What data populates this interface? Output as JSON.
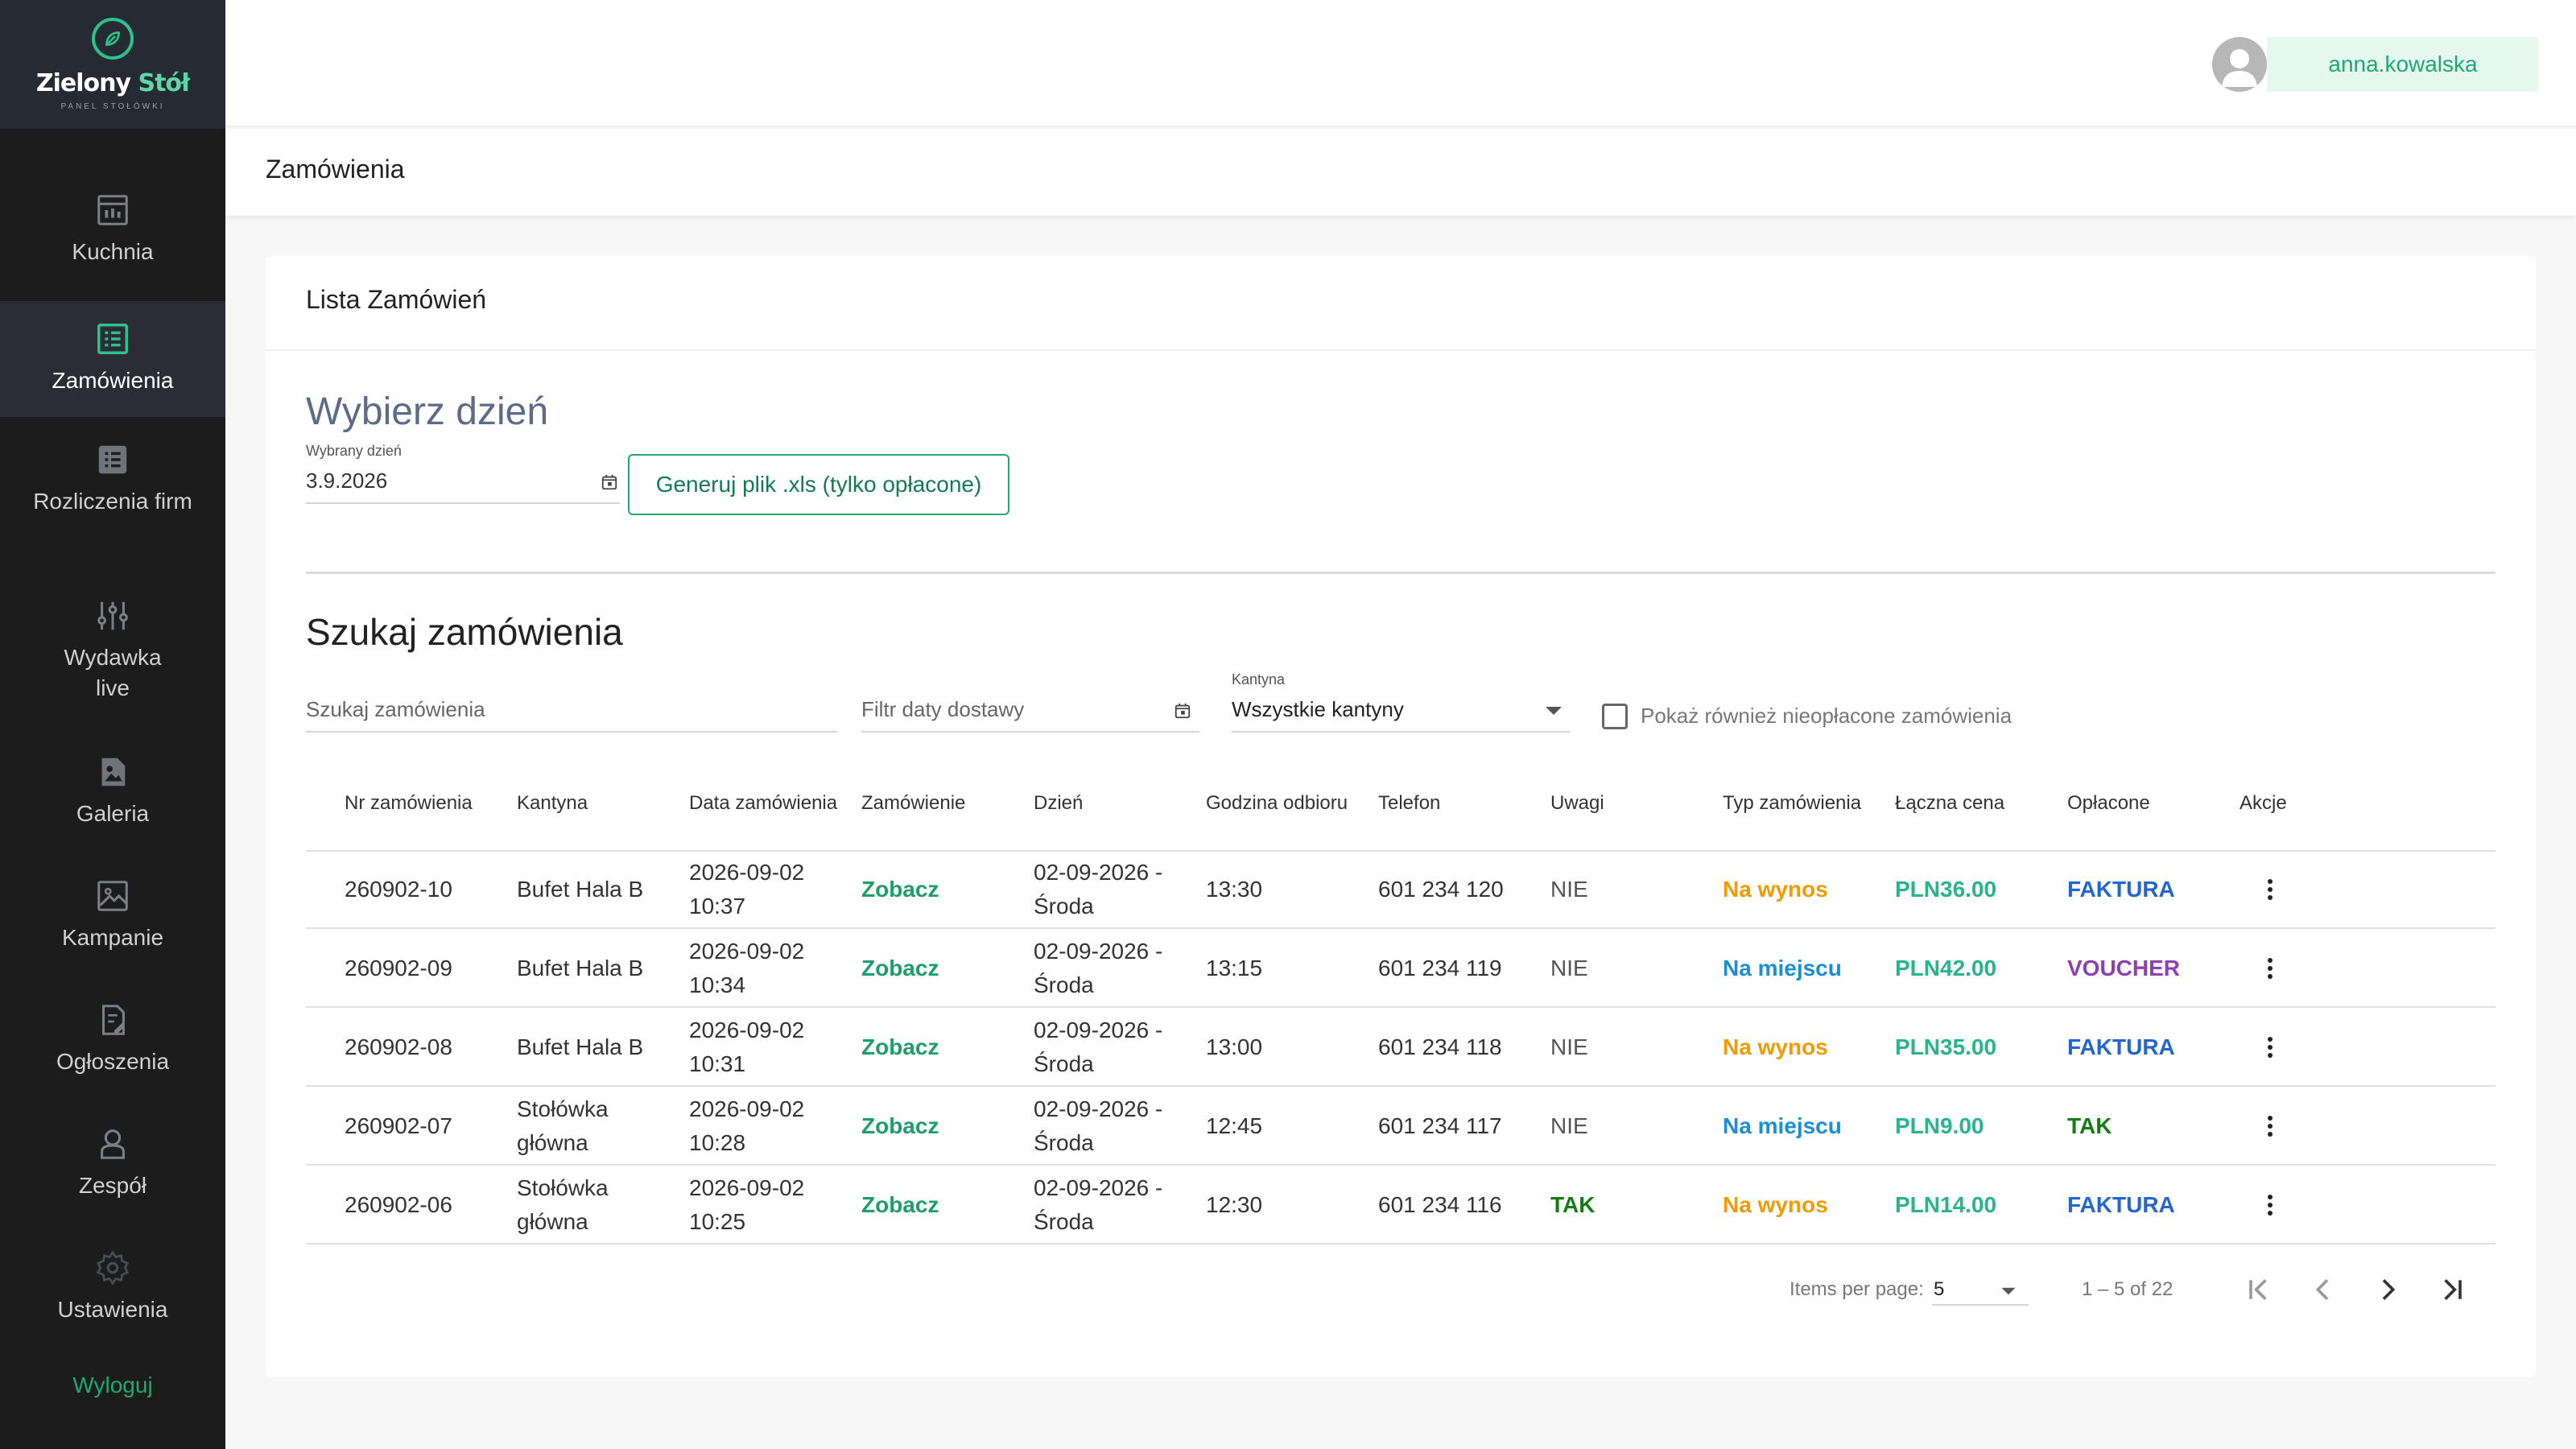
{
  "brand": {
    "title_main": "Zielony ",
    "title_accent": "Stół",
    "subtitle": "PANEL STOŁÓWKI"
  },
  "sidebar": {
    "items": [
      {
        "label": "Kuchnia",
        "icon": "kitchen-icon"
      },
      {
        "label": "Zamówienia",
        "icon": "list-icon",
        "active": true
      },
      {
        "label": "Rozliczenia firm",
        "icon": "list-alt-icon"
      },
      {
        "label": "Wydawka live",
        "icon": "sliders-icon"
      },
      {
        "label": "Galeria",
        "icon": "gallery-icon"
      },
      {
        "label": "Kampanie",
        "icon": "image-icon"
      },
      {
        "label": "Ogłoszenia",
        "icon": "document-edit-icon"
      },
      {
        "label": "Zespół",
        "icon": "person-icon"
      },
      {
        "label": "Ustawienia",
        "icon": "gear-icon"
      }
    ],
    "logout": "Wyloguj"
  },
  "header": {
    "username": "anna.kowalska",
    "breadcrumb": "Zamówienia"
  },
  "card": {
    "title": "Lista Zamówień"
  },
  "choose_day": {
    "heading": "Wybierz dzień",
    "date_label": "Wybrany dzień",
    "date_value": "3.9.2026",
    "xls_button": "Generuj plik .xls (tylko opłacone)"
  },
  "search": {
    "heading": "Szukaj zamówienia",
    "search_placeholder": "Szukaj zamówienia",
    "date_filter_placeholder": "Filtr daty dostawy",
    "canteen_label": "Kantyna",
    "canteen_value": "Wszystkie kantyny",
    "unpaid_checkbox_label": "Pokaż również nieopłacone zamówienia"
  },
  "table": {
    "headers": [
      "Nr zamówienia",
      "Kantyna",
      "Data zamówienia",
      "Zamówienie",
      "Dzień",
      "Godzina odbioru",
      "Telefon",
      "Uwagi",
      "Typ zamówienia",
      "Łączna cena",
      "Opłacone",
      "Akcje"
    ],
    "rows": [
      {
        "nr": "260902-10",
        "kantyna": "Bufet Hala B",
        "data": "2026-09-02 10:37",
        "zamowienie": "Zobacz",
        "dzien": "02-09-2026 - Środa",
        "godzina": "13:30",
        "telefon": "601 234 120",
        "uwagi": "NIE",
        "typ": "Na wynos",
        "cena": "PLN36.00",
        "oplacone": "FAKTURA"
      },
      {
        "nr": "260902-09",
        "kantyna": "Bufet Hala B",
        "data": "2026-09-02 10:34",
        "zamowienie": "Zobacz",
        "dzien": "02-09-2026 - Środa",
        "godzina": "13:15",
        "telefon": "601 234 119",
        "uwagi": "NIE",
        "typ": "Na miejscu",
        "cena": "PLN42.00",
        "oplacone": "VOUCHER"
      },
      {
        "nr": "260902-08",
        "kantyna": "Bufet Hala B",
        "data": "2026-09-02 10:31",
        "zamowienie": "Zobacz",
        "dzien": "02-09-2026 - Środa",
        "godzina": "13:00",
        "telefon": "601 234 118",
        "uwagi": "NIE",
        "typ": "Na wynos",
        "cena": "PLN35.00",
        "oplacone": "FAKTURA"
      },
      {
        "nr": "260902-07",
        "kantyna": "Stołówka główna",
        "data": "2026-09-02 10:28",
        "zamowienie": "Zobacz",
        "dzien": "02-09-2026 - Środa",
        "godzina": "12:45",
        "telefon": "601 234 117",
        "uwagi": "NIE",
        "typ": "Na miejscu",
        "cena": "PLN9.00",
        "oplacone": "TAK"
      },
      {
        "nr": "260902-06",
        "kantyna": "Stołówka główna",
        "data": "2026-09-02 10:25",
        "zamowienie": "Zobacz",
        "dzien": "02-09-2026 - Środa",
        "godzina": "12:30",
        "telefon": "601 234 116",
        "uwagi": "TAK",
        "typ": "Na wynos",
        "cena": "PLN14.00",
        "oplacone": "FAKTURA"
      }
    ]
  },
  "paginator": {
    "items_per_page_label": "Items per page:",
    "items_per_page": "5",
    "range": "1 – 5 of 22"
  },
  "colors": {
    "green": "#1e9e6a",
    "teal": "#28b48c",
    "orange": "#f29a00",
    "blue": "#1a8fd6",
    "faktura": "#2466d1",
    "voucher": "#8e3fb0",
    "tak": "#137d13"
  }
}
